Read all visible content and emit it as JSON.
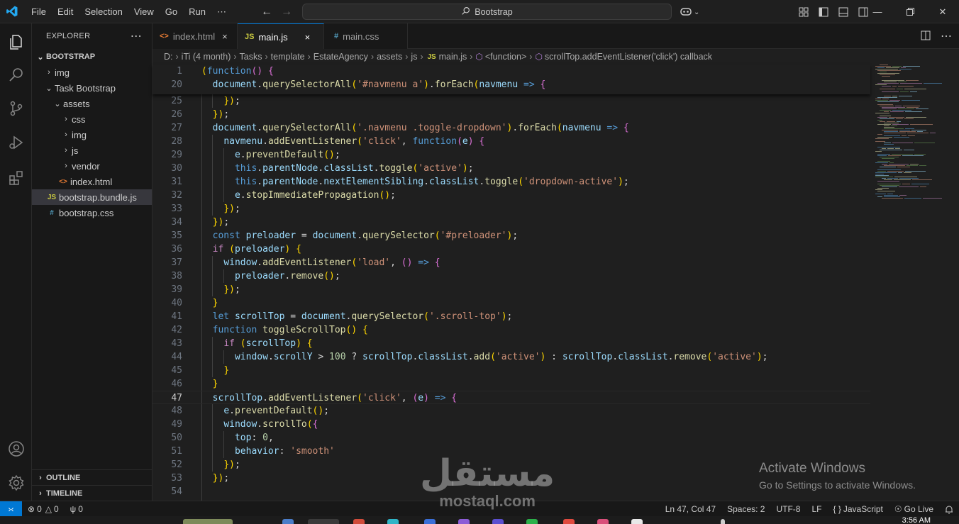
{
  "menu": [
    "File",
    "Edit",
    "Selection",
    "View",
    "Go",
    "Run",
    "⋯"
  ],
  "search": {
    "label": "Bootstrap"
  },
  "explorer": {
    "title": "EXPLORER",
    "root": "BOOTSTRAP",
    "items": [
      {
        "label": "img",
        "type": "folder",
        "open": false,
        "depth": 1
      },
      {
        "label": "Task Bootstrap",
        "type": "folder",
        "open": true,
        "depth": 1
      },
      {
        "label": "assets",
        "type": "folder",
        "open": true,
        "depth": 2
      },
      {
        "label": "css",
        "type": "folder",
        "open": false,
        "depth": 3
      },
      {
        "label": "img",
        "type": "folder",
        "open": false,
        "depth": 3
      },
      {
        "label": "js",
        "type": "folder",
        "open": false,
        "depth": 3
      },
      {
        "label": "vendor",
        "type": "folder",
        "open": false,
        "depth": 3
      },
      {
        "label": "index.html",
        "type": "html",
        "depth": 2
      },
      {
        "label": "bootstrap.bundle.js",
        "type": "js",
        "depth": 1,
        "selected": true
      },
      {
        "label": "bootstrap.css",
        "type": "css",
        "depth": 1
      }
    ],
    "outline": "OUTLINE",
    "timeline": "TIMELINE"
  },
  "tabs": [
    {
      "label": "index.html",
      "icon": "<>",
      "active": false
    },
    {
      "label": "main.js",
      "icon": "JS",
      "active": true
    },
    {
      "label": "main.css",
      "icon": "#",
      "active": false
    }
  ],
  "breadcrumb": [
    "D:",
    "iTi (4 month)",
    "Tasks",
    "template",
    "EstateAgency",
    "assets",
    "js",
    "main.js",
    "<function>",
    "scrollTop.addEventListener('click') callback"
  ],
  "sticky_lines": [
    {
      "n": "1",
      "code": "(function() {"
    },
    {
      "n": "20",
      "code": "  document.querySelectorAll('#navmenu a').forEach(navmenu => {"
    }
  ],
  "code_lines": [
    {
      "n": "25",
      "code": "    });"
    },
    {
      "n": "26",
      "code": "  });"
    },
    {
      "n": "27",
      "code": "  document.querySelectorAll('.navmenu .toggle-dropdown').forEach(navmenu => {"
    },
    {
      "n": "28",
      "code": "    navmenu.addEventListener('click', function(e) {"
    },
    {
      "n": "29",
      "code": "      e.preventDefault();"
    },
    {
      "n": "30",
      "code": "      this.parentNode.classList.toggle('active');"
    },
    {
      "n": "31",
      "code": "      this.parentNode.nextElementSibling.classList.toggle('dropdown-active');"
    },
    {
      "n": "32",
      "code": "      e.stopImmediatePropagation();"
    },
    {
      "n": "33",
      "code": "    });"
    },
    {
      "n": "34",
      "code": "  });"
    },
    {
      "n": "35",
      "code": "  const preloader = document.querySelector('#preloader');"
    },
    {
      "n": "36",
      "code": "  if (preloader) {"
    },
    {
      "n": "37",
      "code": "    window.addEventListener('load', () => {"
    },
    {
      "n": "38",
      "code": "      preloader.remove();"
    },
    {
      "n": "39",
      "code": "    });"
    },
    {
      "n": "40",
      "code": "  }"
    },
    {
      "n": "41",
      "code": "  let scrollTop = document.querySelector('.scroll-top');"
    },
    {
      "n": "42",
      "code": "  function toggleScrollTop() {"
    },
    {
      "n": "43",
      "code": "    if (scrollTop) {"
    },
    {
      "n": "44",
      "code": "      window.scrollY > 100 ? scrollTop.classList.add('active') : scrollTop.classList.remove('active');"
    },
    {
      "n": "45",
      "code": "    }"
    },
    {
      "n": "46",
      "code": "  }"
    },
    {
      "n": "47",
      "code": "  scrollTop.addEventListener('click', (e) => {",
      "current": true
    },
    {
      "n": "48",
      "code": "    e.preventDefault();"
    },
    {
      "n": "49",
      "code": "    window.scrollTo({"
    },
    {
      "n": "50",
      "code": "      top: 0,"
    },
    {
      "n": "51",
      "code": "      behavior: 'smooth'"
    },
    {
      "n": "52",
      "code": "    });"
    },
    {
      "n": "53",
      "code": "  });"
    },
    {
      "n": "54",
      "code": ""
    }
  ],
  "status": {
    "errors": "0",
    "warnings": "0",
    "ports": "0",
    "position": "Ln 47, Col 47",
    "spaces": "Spaces: 2",
    "encoding": "UTF-8",
    "eol": "LF",
    "language": "JavaScript",
    "golive": "Go Live"
  },
  "taskbar_time": "3:56 AM",
  "activation": {
    "title": "Activate Windows",
    "subtitle": "Go to Settings to activate Windows."
  },
  "watermark": {
    "arabic": "مستقل",
    "latin": "mostaql.com"
  },
  "colors": {
    "accent": "#0078d4",
    "background": "#1f1f1f",
    "sidebar": "#181818"
  }
}
